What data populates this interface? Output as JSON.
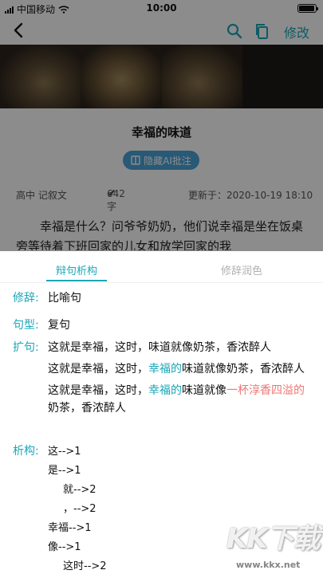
{
  "status_bar": {
    "carrier": "中国移动",
    "time": "10:00"
  },
  "nav": {
    "edit_label": "修改",
    "icons": [
      "back-icon",
      "search-icon",
      "copy-icon"
    ]
  },
  "article": {
    "title": "幸福的味道",
    "ai_badge": "隐藏AI批注",
    "grade": "高中 记叙文",
    "words": "642字",
    "updated": "更新于：2020-10-19 18:10",
    "body": "幸福是什么？问爷爷奶奶，他们说幸福是坐在饭桌旁等待着下班回家的儿女和放学回家的我"
  },
  "sheet": {
    "tab_analysis": "辩句析构",
    "tab_polish": "修辞润色",
    "rhetoric_label": "修辞:",
    "rhetoric_value": "比喻句",
    "type_label": "句型:",
    "type_value": "复句",
    "expand_label": "扩句:",
    "expand": {
      "line1": "这就是幸福，这时，味道就像奶茶，香浓醉人",
      "line2_a": "这就是幸福，这时，",
      "line2_hl": "幸福的",
      "line2_b": "味道就像奶茶，香浓醉人",
      "line3_a": "这就是幸福，这时，",
      "line3_hl": "幸福的",
      "line3_b": "味道就像",
      "line3_red": "一杯淳香四溢的",
      "line3_c": "奶茶，香浓醉人"
    },
    "analysis_label": "析构:",
    "analysis": [
      "这-->1",
      "是-->1",
      "就-->2",
      "，-->2",
      "幸福-->1",
      "像-->1",
      "这时-->2"
    ]
  },
  "watermark": {
    "text": "KK下载",
    "url": "www.kkx.net"
  },
  "colors": {
    "accent": "#1aa7b8",
    "highlight_red": "#f07777",
    "badge": "#4aa3d8"
  }
}
